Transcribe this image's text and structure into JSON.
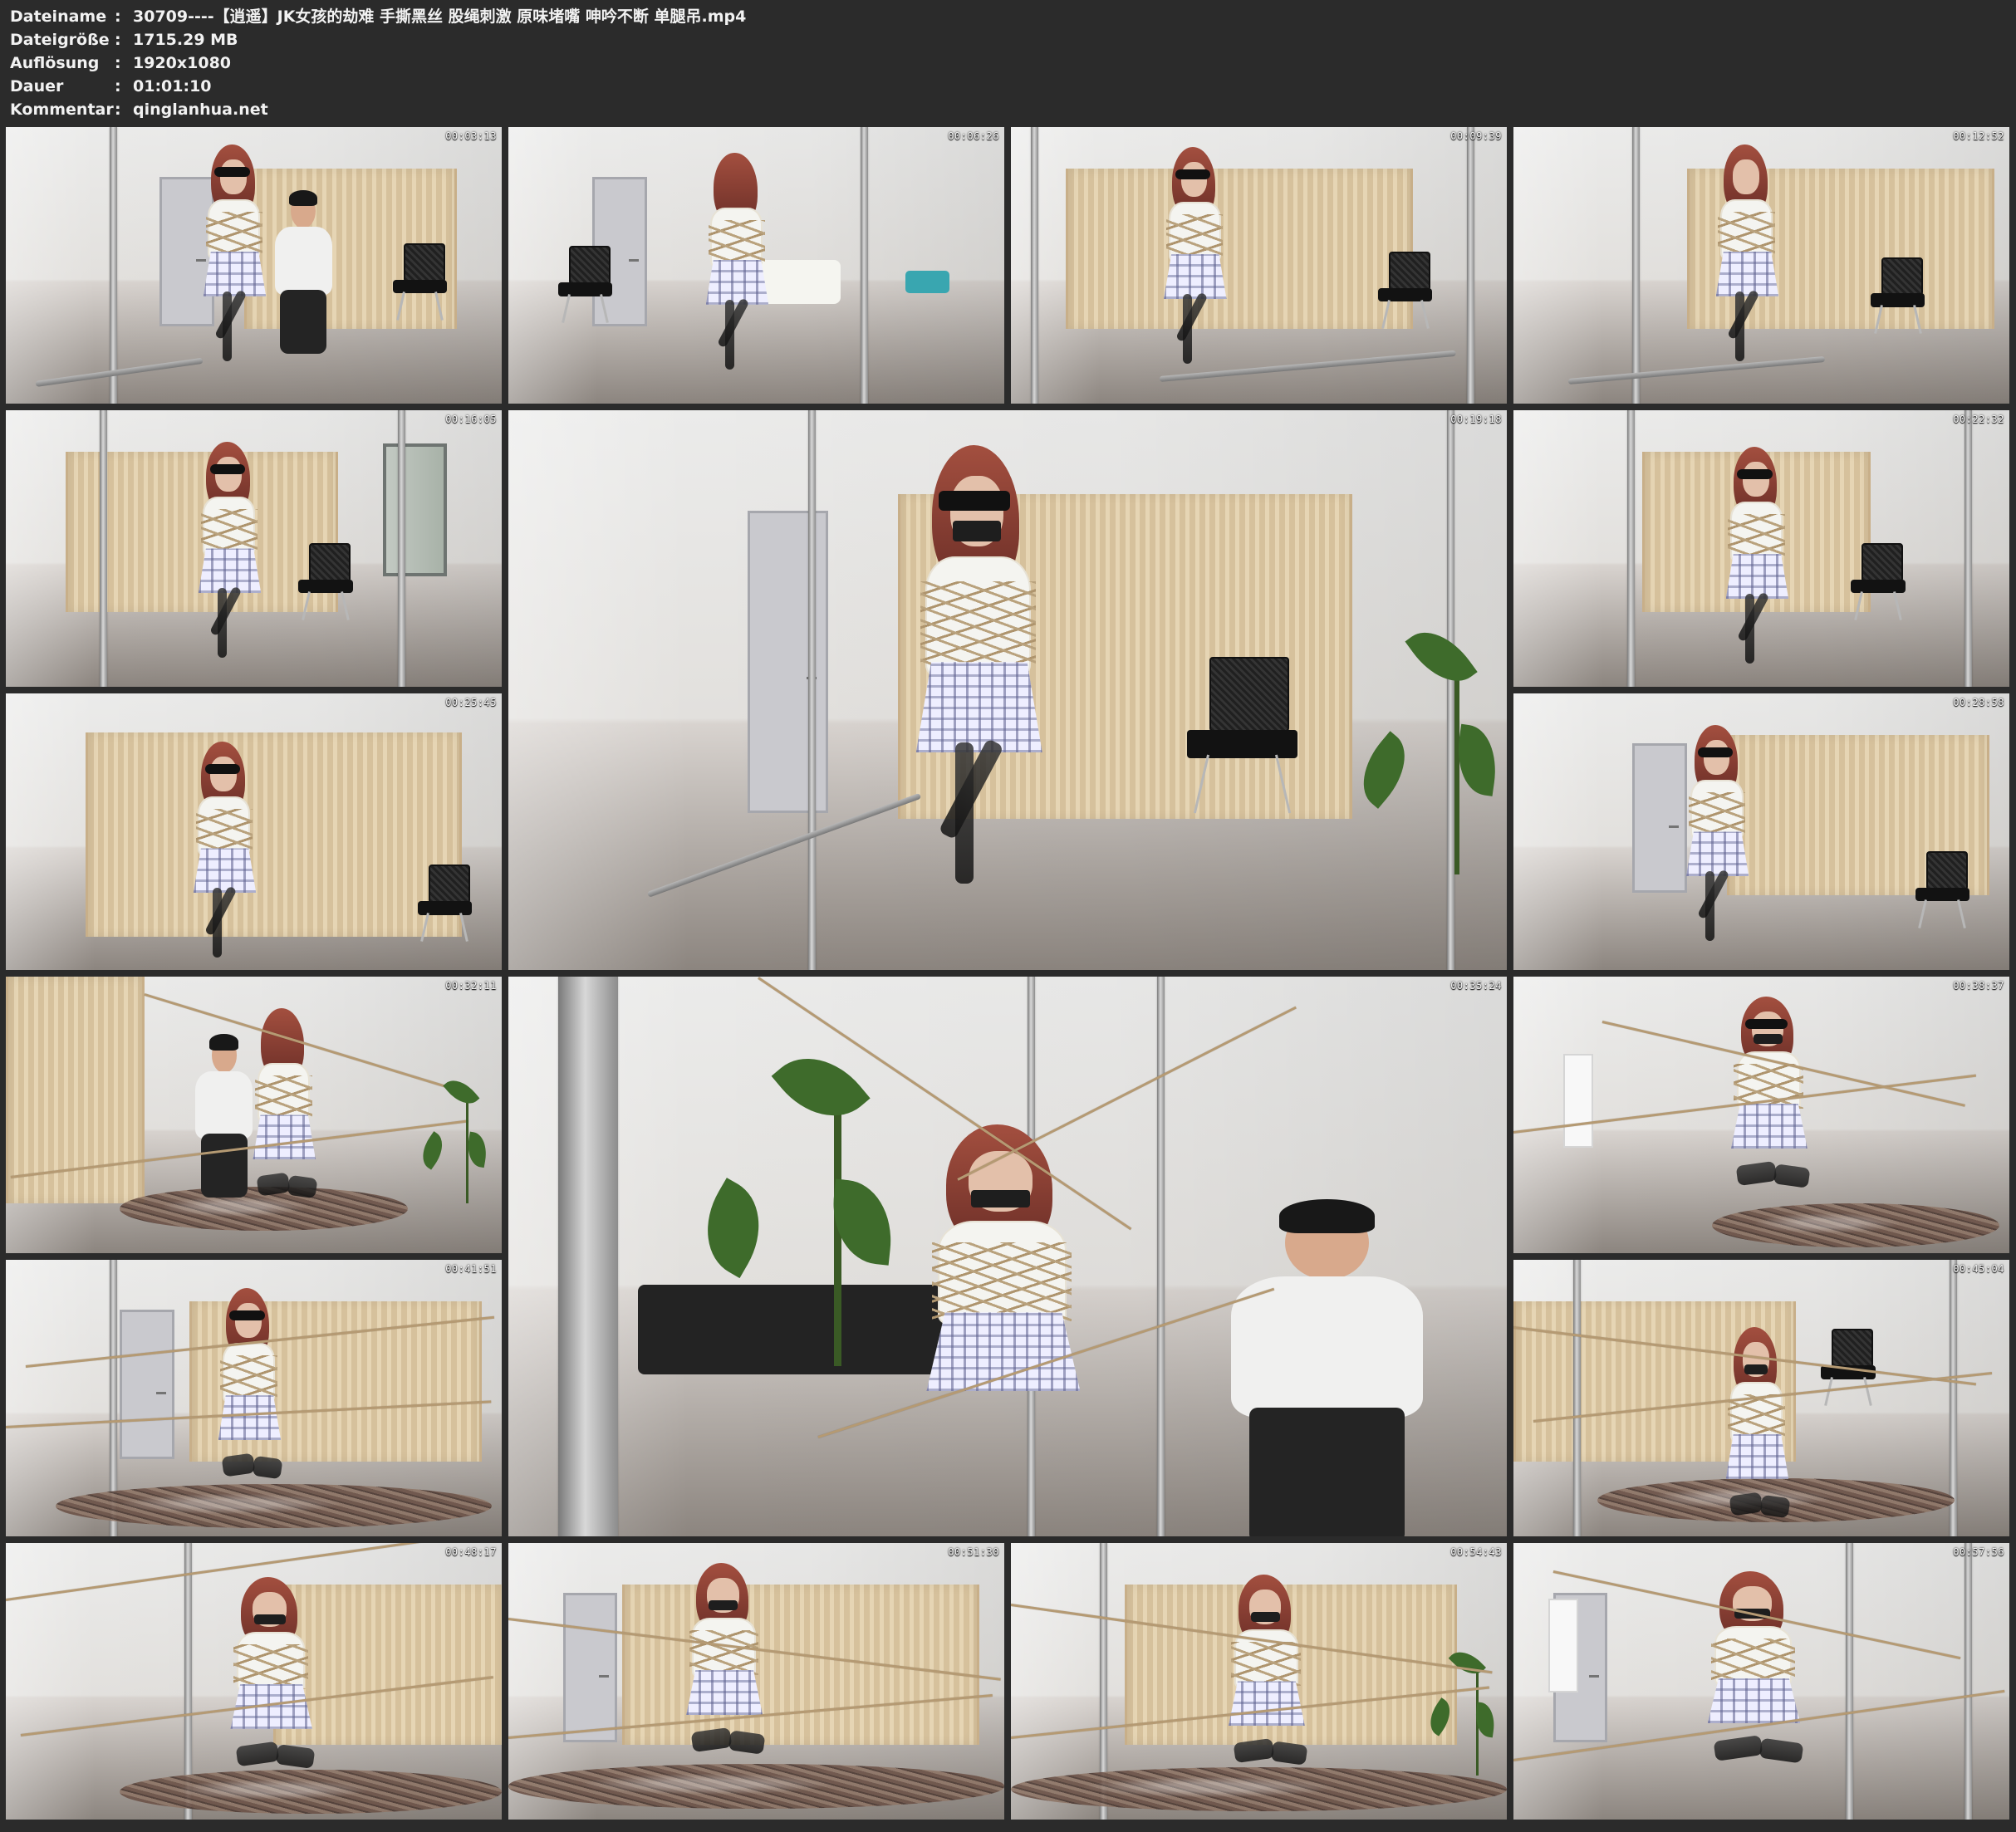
{
  "header": {
    "rows": [
      {
        "label": "Dateiname",
        "value": "30709----【逍遥】JK女孩的劫难 手撕黑丝 股绳刺激 原味堵嘴 呻吟不断 单腿吊.mp4"
      },
      {
        "label": "Dateigröße",
        "value": "1715.29 MB"
      },
      {
        "label": "Auflösung",
        "value": "1920x1080"
      },
      {
        "label": "Dauer",
        "value": "01:01:10"
      },
      {
        "label": "Kommentar",
        "value": "qinglanhua.net"
      }
    ],
    "separator": ":"
  },
  "thumbnails": [
    {
      "timestamp": "00:03:13"
    },
    {
      "timestamp": "00:06:26"
    },
    {
      "timestamp": "00:09:39"
    },
    {
      "timestamp": "00:12:52"
    },
    {
      "timestamp": "00:16:05"
    },
    {
      "timestamp": "00:19:18"
    },
    {
      "timestamp": "00:22:32"
    },
    {
      "timestamp": "00:25:45"
    },
    {
      "timestamp": "00:28:58"
    },
    {
      "timestamp": "00:32:11"
    },
    {
      "timestamp": "00:35:24"
    },
    {
      "timestamp": "00:38:37"
    },
    {
      "timestamp": "00:41:51"
    },
    {
      "timestamp": "00:45:04"
    },
    {
      "timestamp": "00:48:17"
    },
    {
      "timestamp": "00:51:30"
    },
    {
      "timestamp": "00:54:43"
    },
    {
      "timestamp": "00:57:56"
    }
  ],
  "colors": {
    "background": "#2b2b2b",
    "text": "#f2f2f2",
    "rope": "#b59a73",
    "screen": "#dbc6a4"
  }
}
